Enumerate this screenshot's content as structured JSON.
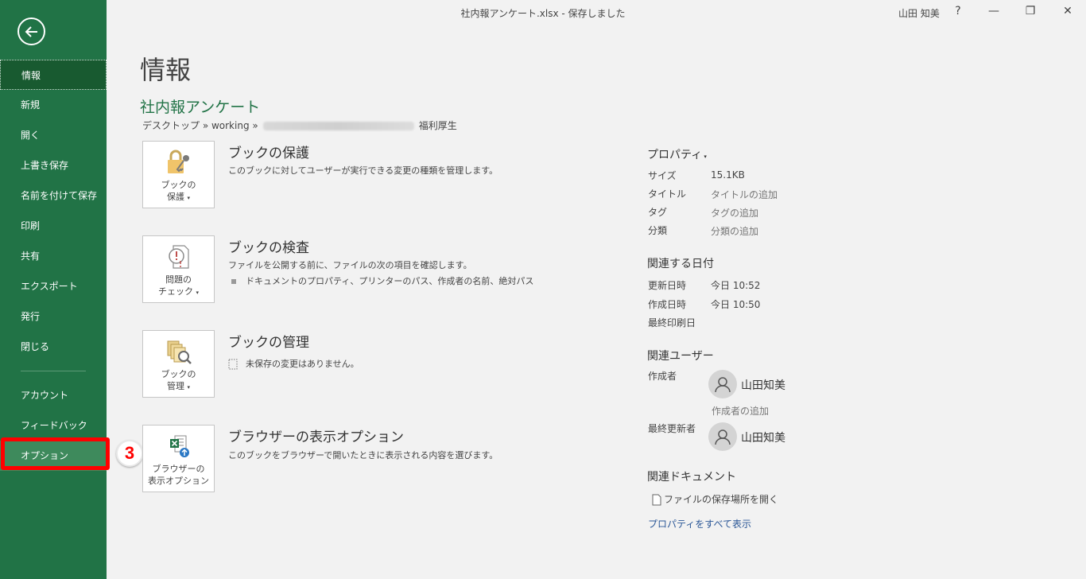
{
  "window": {
    "title": "社内報アンケート.xlsx  -  保存しました",
    "user": "山田 知美",
    "help": "?",
    "minimize": "—",
    "restore": "❐",
    "close": "✕"
  },
  "sidebar": {
    "items": [
      {
        "label": "情報"
      },
      {
        "label": "新規"
      },
      {
        "label": "開く"
      },
      {
        "label": "上書き保存"
      },
      {
        "label": "名前を付けて保存"
      },
      {
        "label": "印刷"
      },
      {
        "label": "共有"
      },
      {
        "label": "エクスポート"
      },
      {
        "label": "発行"
      },
      {
        "label": "閉じる"
      }
    ],
    "bottom_items": [
      {
        "label": "アカウント"
      },
      {
        "label": "フィードバック"
      },
      {
        "label": "オプション"
      }
    ],
    "step_badge": "3"
  },
  "main": {
    "page_title": "情報",
    "doc_title": "社内報アンケート",
    "breadcrumb": {
      "part1": "デスクトップ » working »",
      "part2": "福利厚生"
    },
    "sections": [
      {
        "card_line1": "ブックの",
        "card_line2": "保護",
        "title": "ブックの保護",
        "desc": "このブックに対してユーザーが実行できる変更の種類を管理します。"
      },
      {
        "card_line1": "問題の",
        "card_line2": "チェック",
        "title": "ブックの検査",
        "desc": "ファイルを公開する前に、ファイルの次の項目を確認します。",
        "bullet": "ドキュメントのプロパティ、プリンターのパス、作成者の名前、絶対パス"
      },
      {
        "card_line1": "ブックの",
        "card_line2": "管理",
        "title": "ブックの管理",
        "desc": "未保存の変更はありません。"
      },
      {
        "card_line1": "ブラウザーの",
        "card_line2": "表示オプション",
        "title": "ブラウザーの表示オプション",
        "desc": "このブックをブラウザーで開いたときに表示される内容を選びます。"
      }
    ]
  },
  "properties": {
    "head": "プロパティ",
    "size_label": "サイズ",
    "size_value": "15.1KB",
    "title_label": "タイトル",
    "title_value": "タイトルの追加",
    "tag_label": "タグ",
    "tag_value": "タグの追加",
    "category_label": "分類",
    "category_value": "分類の追加",
    "dates_head": "関連する日付",
    "modified_label": "更新日時",
    "modified_value": "今日 10:52",
    "created_label": "作成日時",
    "created_value": "今日 10:50",
    "printed_label": "最終印刷日",
    "users_head": "関連ユーザー",
    "author_label": "作成者",
    "author_name": "山田知美",
    "add_author": "作成者の追加",
    "last_modified_by_label": "最終更新者",
    "last_modified_by_name": "山田知美",
    "docs_head": "関連ドキュメント",
    "open_location": "ファイルの保存場所を開く",
    "show_all": "プロパティをすべて表示"
  }
}
